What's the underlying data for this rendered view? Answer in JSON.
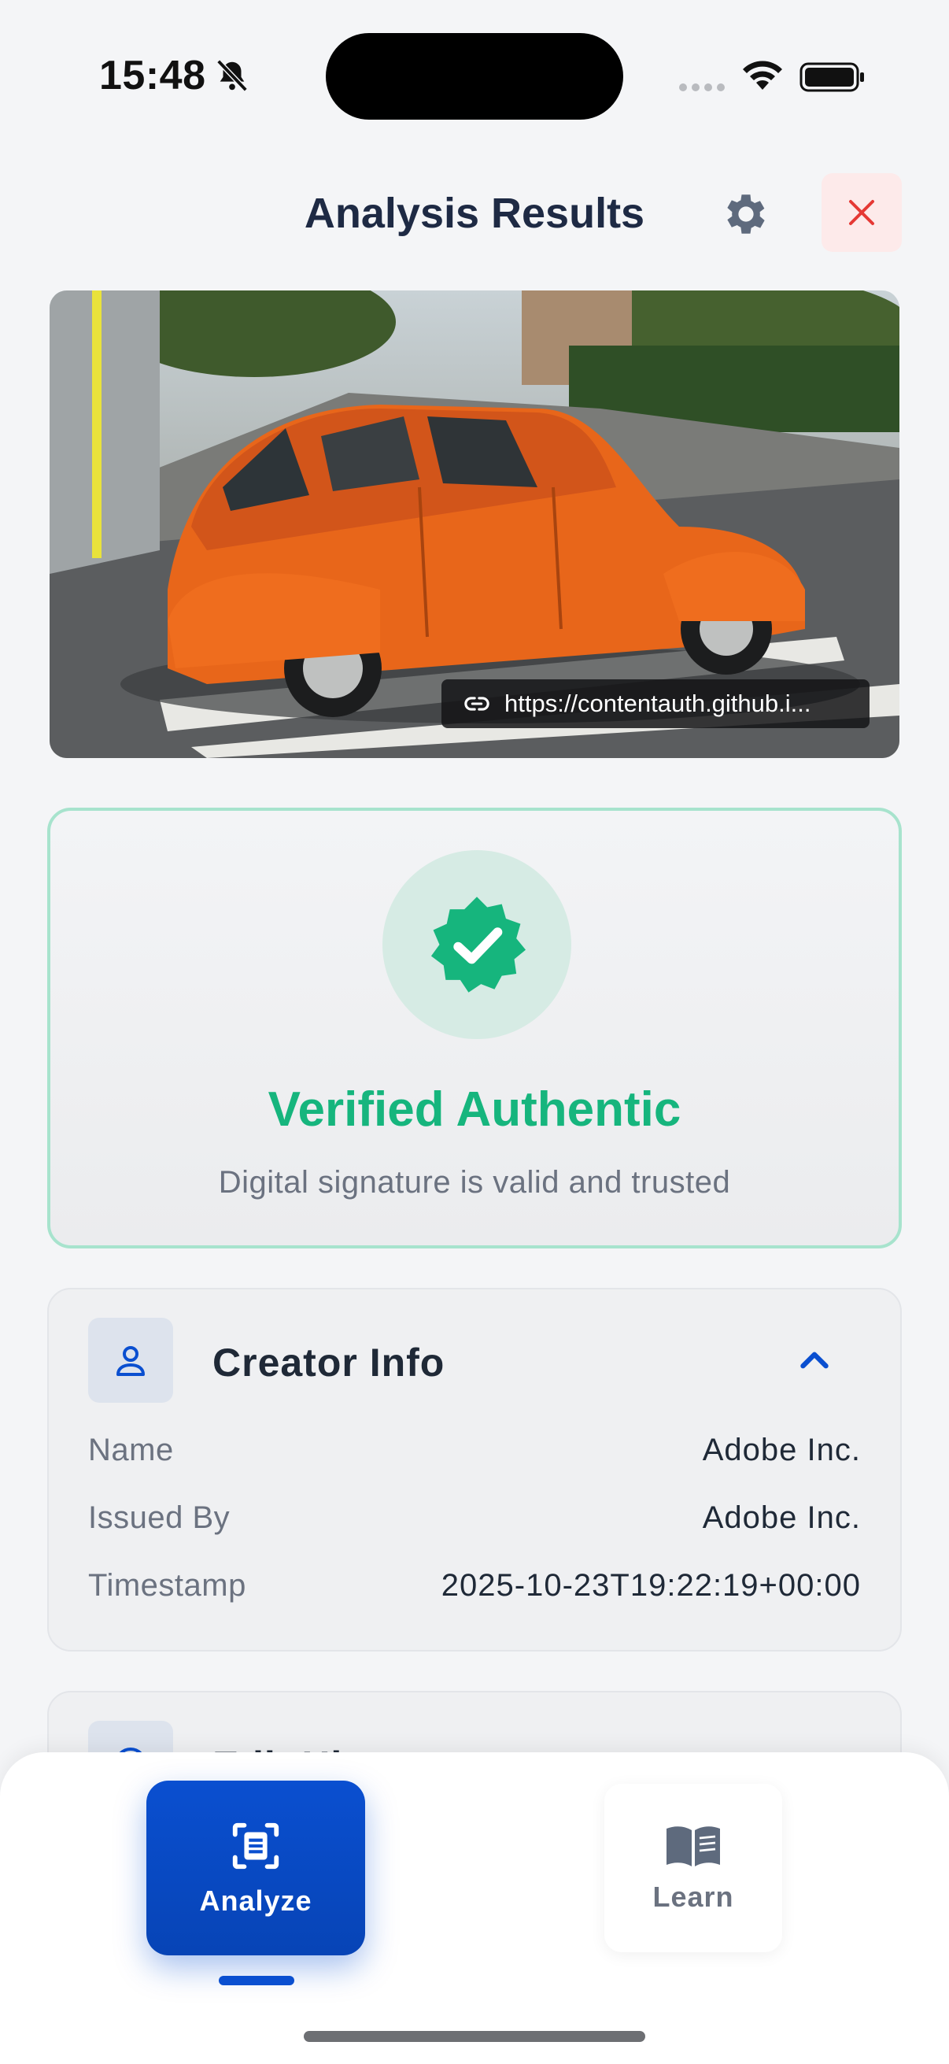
{
  "status_bar": {
    "time": "15:48",
    "icons": [
      "bell-slash-icon",
      "cellular-signal-icon",
      "wifi-icon",
      "battery-icon"
    ]
  },
  "header": {
    "title": "Analysis Results",
    "settings_icon": "gear-icon",
    "close_icon": "close-icon",
    "close_color": "#e53935"
  },
  "image_preview": {
    "source_url": "https://contentauth.github.i...",
    "link_icon": "link-icon"
  },
  "verification": {
    "title": "Verified Authentic",
    "subtitle": "Digital signature is valid and trusted",
    "icon": "verified-badge-icon",
    "color": "#16b57d"
  },
  "creator_info": {
    "title": "Creator Info",
    "icon": "person-icon",
    "expanded": true,
    "rows": [
      {
        "label": "Name",
        "value": "Adobe Inc."
      },
      {
        "label": "Issued By",
        "value": "Adobe Inc."
      },
      {
        "label": "Timestamp",
        "value": "2025-10-23T19:22:19+00:00"
      }
    ]
  },
  "edit_history": {
    "title": "Edit History",
    "icon": "history-icon"
  },
  "bottom_nav": {
    "tabs": [
      {
        "label": "Analyze",
        "icon": "scan-document-icon",
        "active": true
      },
      {
        "label": "Learn",
        "icon": "book-icon",
        "active": false
      }
    ],
    "accent": "#0a4fd0"
  }
}
